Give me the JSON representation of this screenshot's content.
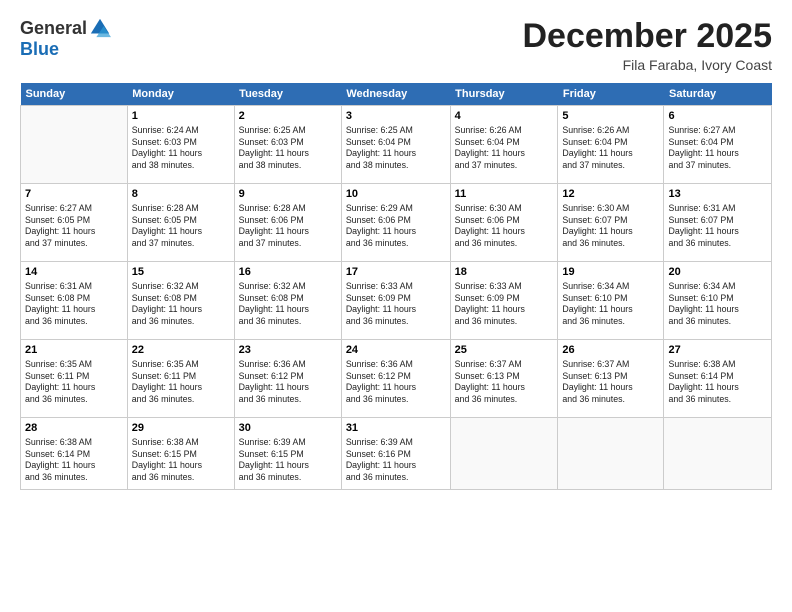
{
  "logo": {
    "general": "General",
    "blue": "Blue"
  },
  "title": {
    "month": "December 2025",
    "location": "Fila Faraba, Ivory Coast"
  },
  "days_of_week": [
    "Sunday",
    "Monday",
    "Tuesday",
    "Wednesday",
    "Thursday",
    "Friday",
    "Saturday"
  ],
  "weeks": [
    [
      {
        "num": "",
        "info": ""
      },
      {
        "num": "1",
        "info": "Sunrise: 6:24 AM\nSunset: 6:03 PM\nDaylight: 11 hours\nand 38 minutes."
      },
      {
        "num": "2",
        "info": "Sunrise: 6:25 AM\nSunset: 6:03 PM\nDaylight: 11 hours\nand 38 minutes."
      },
      {
        "num": "3",
        "info": "Sunrise: 6:25 AM\nSunset: 6:04 PM\nDaylight: 11 hours\nand 38 minutes."
      },
      {
        "num": "4",
        "info": "Sunrise: 6:26 AM\nSunset: 6:04 PM\nDaylight: 11 hours\nand 37 minutes."
      },
      {
        "num": "5",
        "info": "Sunrise: 6:26 AM\nSunset: 6:04 PM\nDaylight: 11 hours\nand 37 minutes."
      },
      {
        "num": "6",
        "info": "Sunrise: 6:27 AM\nSunset: 6:04 PM\nDaylight: 11 hours\nand 37 minutes."
      }
    ],
    [
      {
        "num": "7",
        "info": "Sunrise: 6:27 AM\nSunset: 6:05 PM\nDaylight: 11 hours\nand 37 minutes."
      },
      {
        "num": "8",
        "info": "Sunrise: 6:28 AM\nSunset: 6:05 PM\nDaylight: 11 hours\nand 37 minutes."
      },
      {
        "num": "9",
        "info": "Sunrise: 6:28 AM\nSunset: 6:06 PM\nDaylight: 11 hours\nand 37 minutes."
      },
      {
        "num": "10",
        "info": "Sunrise: 6:29 AM\nSunset: 6:06 PM\nDaylight: 11 hours\nand 36 minutes."
      },
      {
        "num": "11",
        "info": "Sunrise: 6:30 AM\nSunset: 6:06 PM\nDaylight: 11 hours\nand 36 minutes."
      },
      {
        "num": "12",
        "info": "Sunrise: 6:30 AM\nSunset: 6:07 PM\nDaylight: 11 hours\nand 36 minutes."
      },
      {
        "num": "13",
        "info": "Sunrise: 6:31 AM\nSunset: 6:07 PM\nDaylight: 11 hours\nand 36 minutes."
      }
    ],
    [
      {
        "num": "14",
        "info": "Sunrise: 6:31 AM\nSunset: 6:08 PM\nDaylight: 11 hours\nand 36 minutes."
      },
      {
        "num": "15",
        "info": "Sunrise: 6:32 AM\nSunset: 6:08 PM\nDaylight: 11 hours\nand 36 minutes."
      },
      {
        "num": "16",
        "info": "Sunrise: 6:32 AM\nSunset: 6:08 PM\nDaylight: 11 hours\nand 36 minutes."
      },
      {
        "num": "17",
        "info": "Sunrise: 6:33 AM\nSunset: 6:09 PM\nDaylight: 11 hours\nand 36 minutes."
      },
      {
        "num": "18",
        "info": "Sunrise: 6:33 AM\nSunset: 6:09 PM\nDaylight: 11 hours\nand 36 minutes."
      },
      {
        "num": "19",
        "info": "Sunrise: 6:34 AM\nSunset: 6:10 PM\nDaylight: 11 hours\nand 36 minutes."
      },
      {
        "num": "20",
        "info": "Sunrise: 6:34 AM\nSunset: 6:10 PM\nDaylight: 11 hours\nand 36 minutes."
      }
    ],
    [
      {
        "num": "21",
        "info": "Sunrise: 6:35 AM\nSunset: 6:11 PM\nDaylight: 11 hours\nand 36 minutes."
      },
      {
        "num": "22",
        "info": "Sunrise: 6:35 AM\nSunset: 6:11 PM\nDaylight: 11 hours\nand 36 minutes."
      },
      {
        "num": "23",
        "info": "Sunrise: 6:36 AM\nSunset: 6:12 PM\nDaylight: 11 hours\nand 36 minutes."
      },
      {
        "num": "24",
        "info": "Sunrise: 6:36 AM\nSunset: 6:12 PM\nDaylight: 11 hours\nand 36 minutes."
      },
      {
        "num": "25",
        "info": "Sunrise: 6:37 AM\nSunset: 6:13 PM\nDaylight: 11 hours\nand 36 minutes."
      },
      {
        "num": "26",
        "info": "Sunrise: 6:37 AM\nSunset: 6:13 PM\nDaylight: 11 hours\nand 36 minutes."
      },
      {
        "num": "27",
        "info": "Sunrise: 6:38 AM\nSunset: 6:14 PM\nDaylight: 11 hours\nand 36 minutes."
      }
    ],
    [
      {
        "num": "28",
        "info": "Sunrise: 6:38 AM\nSunset: 6:14 PM\nDaylight: 11 hours\nand 36 minutes."
      },
      {
        "num": "29",
        "info": "Sunrise: 6:38 AM\nSunset: 6:15 PM\nDaylight: 11 hours\nand 36 minutes."
      },
      {
        "num": "30",
        "info": "Sunrise: 6:39 AM\nSunset: 6:15 PM\nDaylight: 11 hours\nand 36 minutes."
      },
      {
        "num": "31",
        "info": "Sunrise: 6:39 AM\nSunset: 6:16 PM\nDaylight: 11 hours\nand 36 minutes."
      },
      {
        "num": "",
        "info": ""
      },
      {
        "num": "",
        "info": ""
      },
      {
        "num": "",
        "info": ""
      }
    ]
  ]
}
